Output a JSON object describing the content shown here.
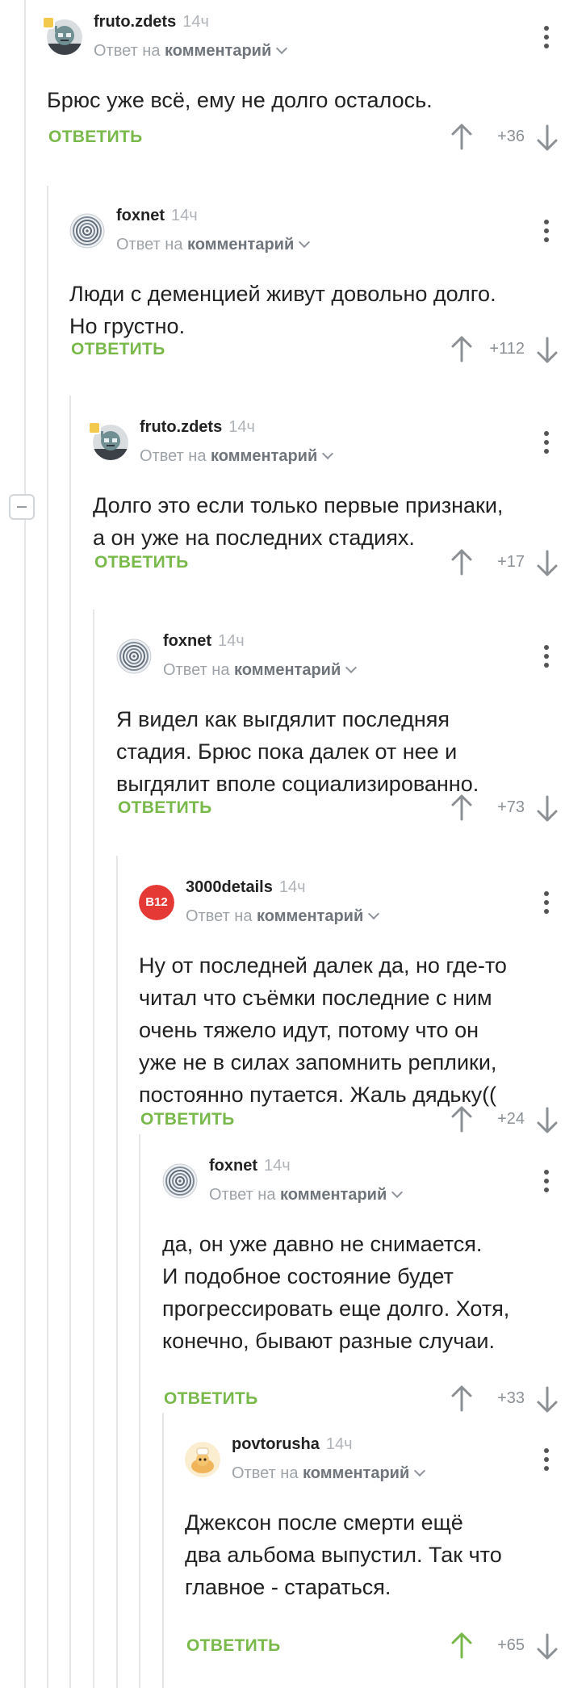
{
  "ui": {
    "reply_prefix": "Ответ на",
    "reply_target": "комментарий",
    "answer_label": "ОТВЕТИТЬ"
  },
  "colors": {
    "accent": "#79b84a",
    "thread_line": "#e4e6e8",
    "muted": "#9ea3a8"
  },
  "comments": [
    {
      "author": "fruto.zdets",
      "time": "14ч",
      "avatar": "robot-avatar-icon",
      "text": [
        "Брюс уже всё, ему не долго осталось."
      ],
      "score": "+36",
      "upvoted": false
    },
    {
      "author": "foxnet",
      "time": "14ч",
      "avatar": "spiral-avatar-icon",
      "text": [
        "Люди с деменцией живут довольно долго.",
        "Но грустно."
      ],
      "score": "+112",
      "upvoted": false
    },
    {
      "author": "fruto.zdets",
      "time": "14ч",
      "avatar": "robot-avatar-icon",
      "text": [
        "Долго это если только первые признаки,",
        "а он уже на последних стадиях."
      ],
      "score": "+17",
      "upvoted": false
    },
    {
      "author": "foxnet",
      "time": "14ч",
      "avatar": "spiral-avatar-icon",
      "text": [
        "Я видел как выгдялит последняя",
        "стадия. Брюс пока далек от нее и",
        "выгдялит вполе социализированно."
      ],
      "score": "+73",
      "upvoted": false
    },
    {
      "author": "3000details",
      "time": "14ч",
      "avatar": "b12-avatar-icon",
      "avatar_text": "B12",
      "text": [
        "Ну от последней далек да, но где-то",
        "читал что съёмки последние с ним",
        "очень тяжело идут, потому что он",
        "уже не в силах запомнить реплики,",
        "постоянно путается. Жаль дядьку(("
      ],
      "score": "+24",
      "upvoted": false
    },
    {
      "author": "foxnet",
      "time": "14ч",
      "avatar": "spiral-avatar-icon",
      "text": [
        "да, он уже давно не снимается.",
        "И подобное состояние будет",
        "прогрессировать еще долго. Хотя,",
        "конечно, бывают разные случаи."
      ],
      "score": "+33",
      "upvoted": false
    },
    {
      "author": "povtorusha",
      "time": "14ч",
      "avatar": "parrot-avatar-icon",
      "text": [
        "Джексон после смерти ещё",
        "два альбома выпустил. Так что",
        "главное - стараться."
      ],
      "score": "+65",
      "upvoted": true
    }
  ]
}
